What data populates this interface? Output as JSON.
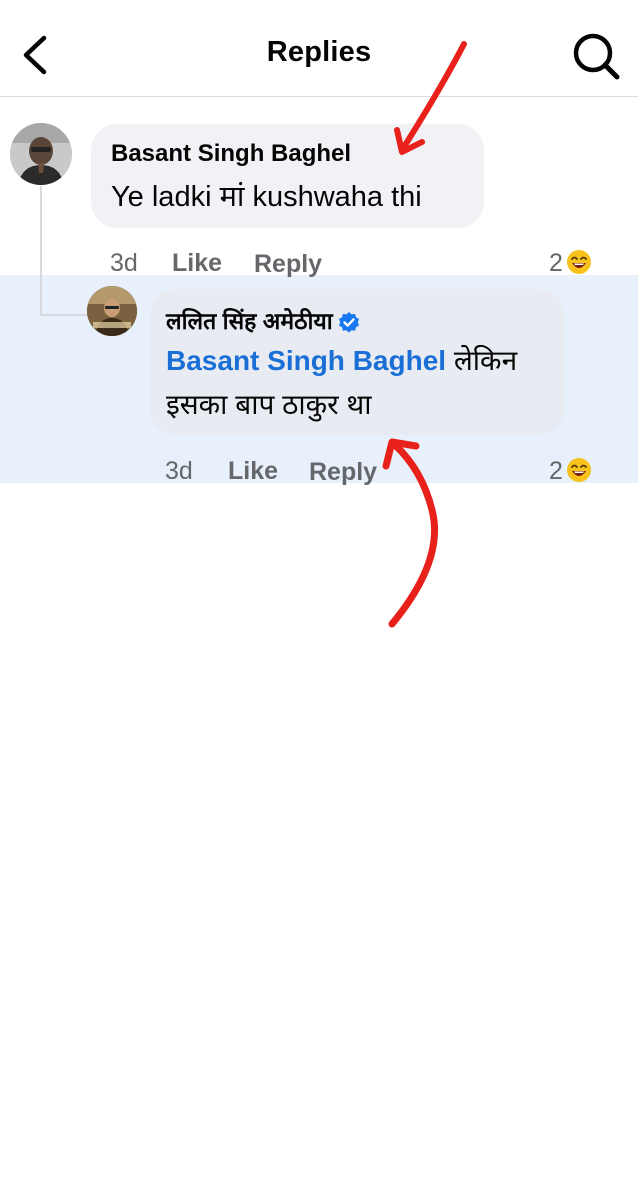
{
  "header": {
    "title": "Replies",
    "back_icon": "chevron-left-icon",
    "search_icon": "search-icon"
  },
  "comment": {
    "author": "Basant Singh Baghel",
    "text": "Ye ladki मां  kushwaha thi",
    "time": "3d",
    "like_label": "Like",
    "reply_label": "Reply",
    "reaction_count": "2",
    "reaction_icon": "laughing-emoji-icon"
  },
  "reply": {
    "author": "ललित सिंह अमेठीया",
    "verified_icon": "verified-badge-icon",
    "mention": "Basant Singh Baghel",
    "text_after_mention": " लेकिन",
    "text_line2": "इसका बाप ठाकुर था",
    "time": "3d",
    "like_label": "Like",
    "reply_label": "Reply",
    "reaction_count": "2",
    "reaction_icon": "laughing-emoji-icon"
  },
  "colors": {
    "mention": "#1a6fd6",
    "highlight_bg": "#e7f0fb",
    "bubble_bg": "#f0f2f5",
    "meta_text": "#65676b",
    "annotation_arrow": "#e8221b"
  }
}
